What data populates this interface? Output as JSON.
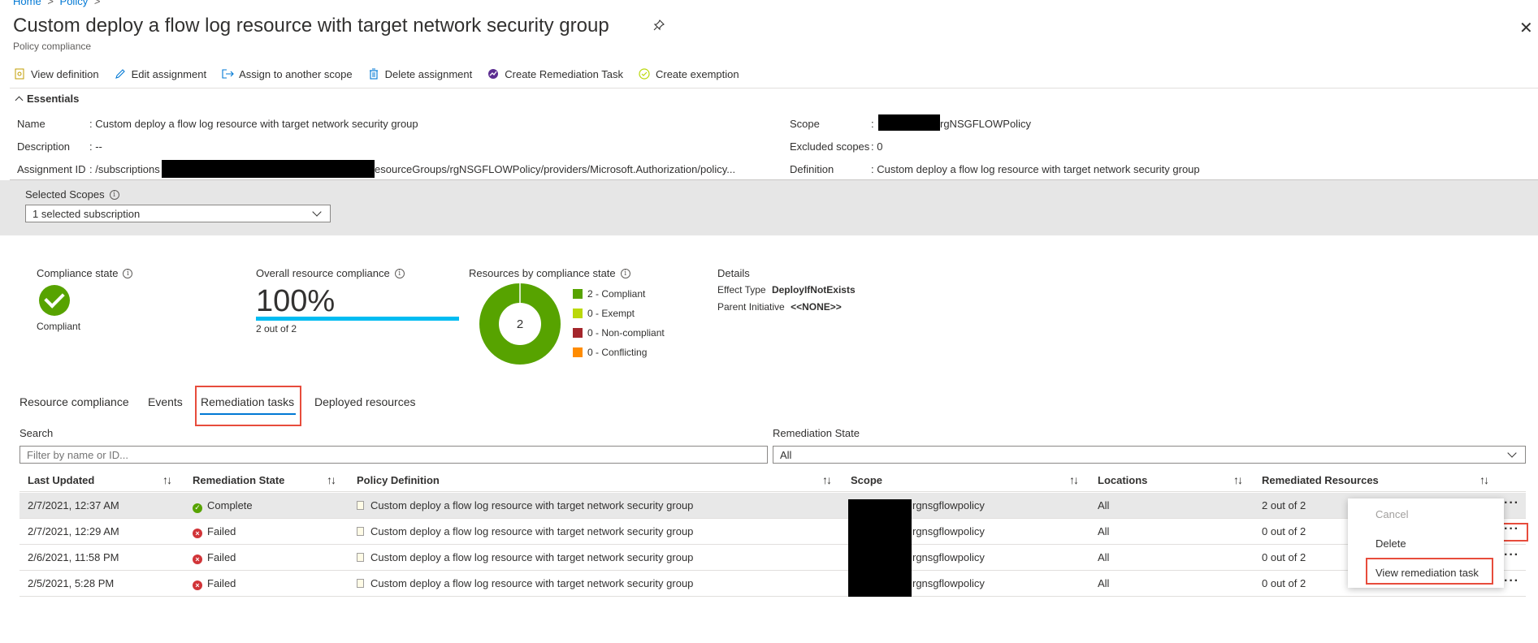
{
  "breadcrumb": {
    "home": "Home",
    "sep": ">",
    "policy": "Policy",
    "sep2": ">"
  },
  "header": {
    "title": "Custom deploy a flow log resource with target network security group",
    "subtitle": "Policy compliance"
  },
  "toolbar": {
    "view_definition": "View definition",
    "edit_assignment": "Edit assignment",
    "assign_scope": "Assign to another scope",
    "delete_assignment": "Delete assignment",
    "create_remediation": "Create Remediation Task",
    "create_exemption": "Create exemption"
  },
  "essentials": {
    "header": "Essentials",
    "name_label": "Name",
    "name_value": ": Custom deploy a flow log resource with target network security group",
    "description_label": "Description",
    "description_value": ": --",
    "assignment_label": "Assignment ID",
    "assignment_prefix": ": /subscriptions",
    "assignment_suffix": "esourceGroups/rgNSGFLOWPolicy/providers/Microsoft.Authorization/policy...",
    "scope_label": "Scope",
    "scope_colon": ":",
    "scope_value": "rgNSGFLOWPolicy",
    "excluded_label": "Excluded scopes",
    "excluded_value": ": 0",
    "definition_label": "Definition",
    "definition_value": ": Custom deploy a flow log resource with target network security group"
  },
  "scopes": {
    "label": "Selected Scopes",
    "value": "1 selected subscription"
  },
  "summary": {
    "compliance_state_label": "Compliance state",
    "compliance_state_value": "Compliant",
    "overall_label": "Overall resource compliance",
    "overall_pct": "100%",
    "overall_fraction": 1.0,
    "overall_count": "2 out of 2",
    "by_state_label": "Resources by compliance state",
    "donut_center": "2",
    "legend": [
      {
        "label": "2 - Compliant",
        "color": "#57a300",
        "count": 2
      },
      {
        "label": "0 - Exempt",
        "color": "#bad80a",
        "count": 0
      },
      {
        "label": "0 - Non-compliant",
        "color": "#a4262c",
        "count": 0
      },
      {
        "label": "0 - Conflicting",
        "color": "#ff8c00",
        "count": 0
      }
    ],
    "details_label": "Details",
    "effect_label": "Effect Type",
    "effect_value": "DeployIfNotExists",
    "parent_label": "Parent Initiative",
    "parent_value": "<<NONE>>"
  },
  "tabs": [
    "Resource compliance",
    "Events",
    "Remediation tasks",
    "Deployed resources"
  ],
  "filters": {
    "search_label": "Search",
    "search_placeholder": "Filter by name or ID...",
    "state_label": "Remediation State",
    "state_value": "All"
  },
  "table": {
    "columns": [
      "Last Updated",
      "Remediation State",
      "Policy Definition",
      "Scope",
      "Locations",
      "Remediated Resources"
    ],
    "rows": [
      {
        "updated": "2/7/2021, 12:37 AM",
        "state": "Complete",
        "definition": "Custom deploy a flow log resource with target network security group",
        "scope": "rgnsgflowpolicy",
        "locations": "All",
        "remediated": "2 out of 2"
      },
      {
        "updated": "2/7/2021, 12:29 AM",
        "state": "Failed",
        "definition": "Custom deploy a flow log resource with target network security group",
        "scope": "rgnsgflowpolicy",
        "locations": "All",
        "remediated": "0 out of 2"
      },
      {
        "updated": "2/6/2021, 11:58 PM",
        "state": "Failed",
        "definition": "Custom deploy a flow log resource with target network security group",
        "scope": "rgnsgflowpolicy",
        "locations": "All",
        "remediated": "0 out of 2"
      },
      {
        "updated": "2/5/2021, 5:28 PM",
        "state": "Failed",
        "definition": "Custom deploy a flow log resource with target network security group",
        "scope": "rgnsgflowpolicy",
        "locations": "All",
        "remediated": "0 out of 2"
      }
    ]
  },
  "context_menu": {
    "cancel": "Cancel",
    "delete": "Delete",
    "view": "View remediation task"
  },
  "icons": {
    "close": "✕",
    "pin": "📌",
    "more": "···",
    "sort": "↑↓"
  }
}
